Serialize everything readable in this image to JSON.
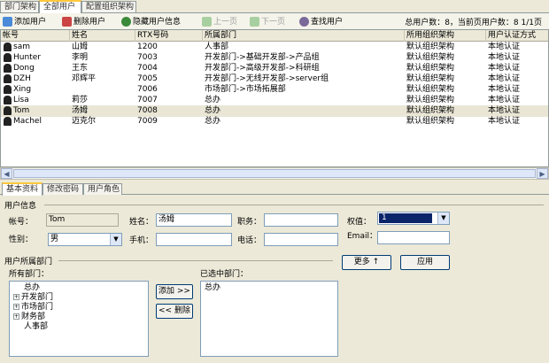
{
  "top_tabs": [
    "部门架构",
    "全部用户",
    "配置组织架构"
  ],
  "toolbar": {
    "add_user": "添加用户",
    "delete_user": "删除用户",
    "hide_user_info": "隐藏用户信息",
    "prev_page": "上一页",
    "next_page": "下一页",
    "find_user": "查找用户",
    "summary": "总用户数：8，当前页用户数：8  1/1页"
  },
  "table": {
    "columns": [
      "帐号",
      "姓名",
      "RTX号码",
      "所属部门",
      "所用组织架构",
      "用户认证方式"
    ],
    "rows": [
      [
        "sam",
        "山姆",
        "1200",
        "人事部",
        "默认组织架构",
        "本地认证"
      ],
      [
        "Hunter",
        "李明",
        "7003",
        "开发部门->基础开发部->产品组",
        "默认组织架构",
        "本地认证"
      ],
      [
        "Dong",
        "王东",
        "7004",
        "开发部门->高级开发部->科研组",
        "默认组织架构",
        "本地认证"
      ],
      [
        "DZH",
        "邓辉平",
        "7005",
        "开发部门->无线开发部->server组",
        "默认组织架构",
        "本地认证"
      ],
      [
        "Xing",
        "",
        "7006",
        "市场部门->市场拓展部",
        "默认组织架构",
        "本地认证"
      ],
      [
        "Lisa",
        "莉莎",
        "7007",
        "总办",
        "默认组织架构",
        "本地认证"
      ],
      [
        "Tom",
        "汤姆",
        "7008",
        "总办",
        "默认组织架构",
        "本地认证"
      ],
      [
        "Machel",
        "迈克尔",
        "7009",
        "总办",
        "默认组织架构",
        "本地认证"
      ]
    ]
  },
  "lower_tabs": [
    "基本资料",
    "修改密码",
    "用户角色"
  ],
  "form": {
    "user_info_title": "用户信息",
    "account_label": "帐号：",
    "account_value": "Tom",
    "name_label": "姓名：",
    "name_value": "汤姆",
    "title_label": "职务：",
    "title_value": "",
    "weight_label": "权值：",
    "weight_value": "1",
    "gender_label": "性别：",
    "gender_value": "男",
    "mobile_label": "手机：",
    "mobile_value": "",
    "phone_label": "电话：",
    "phone_value": "",
    "email_label": "Email：",
    "email_value": "",
    "more_button": "更多 ↑",
    "apply_button": "应用",
    "dept_title": "用户所属部门",
    "all_depts_label": "所有部门：",
    "selected_depts_label": "已选中部门：",
    "add_button": "添加 >>",
    "remove_button": "<< 删除",
    "all_depts": [
      "总办",
      "开发部门",
      "市场部门",
      "财务部",
      "人事部"
    ],
    "selected_depts": [
      "总办"
    ]
  }
}
